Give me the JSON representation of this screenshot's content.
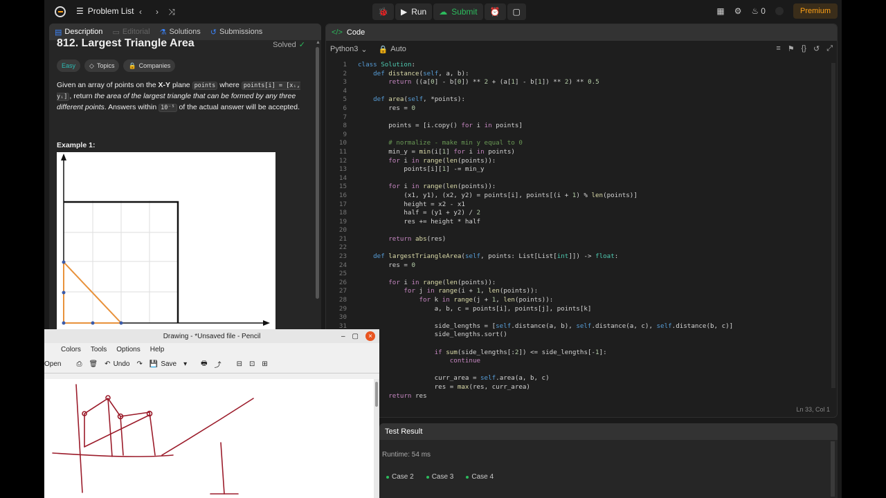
{
  "nav": {
    "problem_list": "Problem List",
    "run": "Run",
    "submit": "Submit",
    "streak": "0",
    "premium": "Premium"
  },
  "left_tabs": [
    {
      "label": "Description"
    },
    {
      "label": "Editorial"
    },
    {
      "label": "Solutions"
    },
    {
      "label": "Submissions"
    }
  ],
  "problem": {
    "title": "812. Largest Triangle Area",
    "status": "Solved",
    "difficulty": "Easy",
    "topics": "Topics",
    "companies": "Companies",
    "desc_1": "Given an array of points on the ",
    "desc_xy": "X-Y",
    "desc_2": " plane ",
    "code_points": "points",
    "desc_3": " where ",
    "code_pointsi": "points[i] = [xᵢ, yᵢ]",
    "desc_4": ", return ",
    "desc_italic": "the area of the largest triangle that can be formed by any three different points",
    "desc_5": ". Answers within ",
    "code_tol": "10⁻⁵",
    "desc_6": " of the actual answer will be accepted.",
    "example_title": "Example 1:"
  },
  "code": {
    "tab": "Code",
    "language": "Python3",
    "auto": "Auto",
    "cursor": "Ln 33, Col 1"
  },
  "test": {
    "title": "Test Result",
    "runtime": "Runtime: 54 ms",
    "cases": [
      "Case 2",
      "Case 3",
      "Case 4"
    ]
  },
  "pencil": {
    "title": "Drawing - *Unsaved file - Pencil",
    "menu": [
      "Colors",
      "Tools",
      "Options",
      "Help"
    ],
    "open": "Open",
    "undo": "Undo",
    "save": "Save"
  },
  "colors": {
    "accent_orange": "#ffa116",
    "submit_green": "#2cbb5d",
    "easy_teal": "#2cbbb4",
    "pen_red": "#9b1b2a"
  }
}
